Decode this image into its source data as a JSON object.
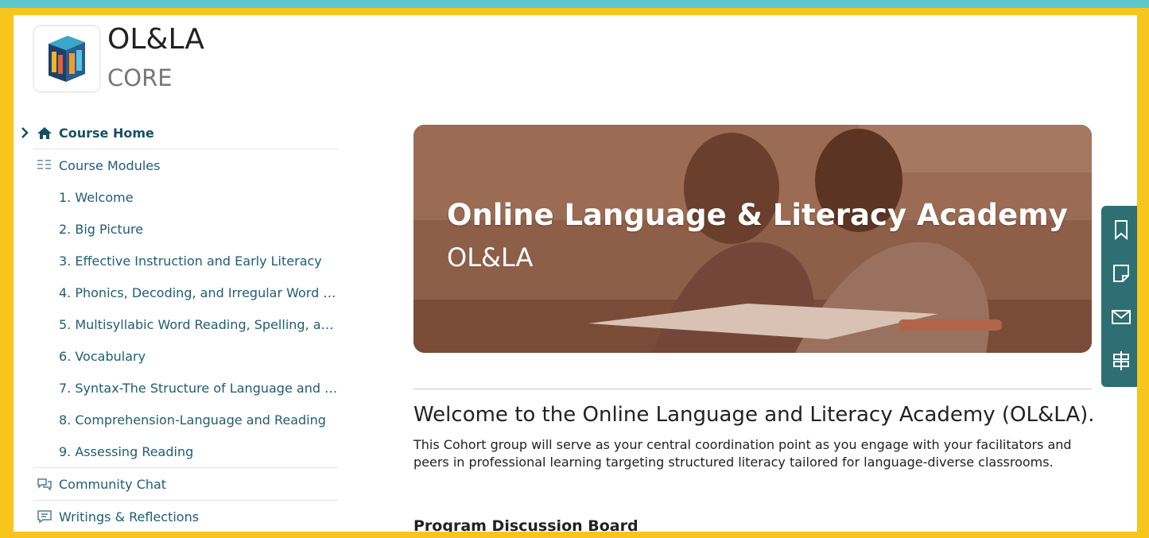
{
  "header": {
    "title": "OL&LA",
    "subtitle": "CORE"
  },
  "sidebar": {
    "home": {
      "label": "Course Home",
      "icon": "home-icon"
    },
    "modules": {
      "label": "Course Modules",
      "icon": "list-icon"
    },
    "module_items": [
      "1. Welcome",
      "2. Big Picture",
      "3. Effective Instruction and Early Literacy",
      "4. Phonics, Decoding, and Irregular Word Re...",
      "5. Multisyllabic Word Reading, Spelling, and...",
      "6. Vocabulary",
      "7. Syntax-The Structure of Language and W...",
      "8. Comprehension-Language and Reading",
      "9. Assessing Reading"
    ],
    "chat": {
      "label": "Community Chat",
      "icon": "chat-icon"
    },
    "writings": {
      "label": "Writings & Reflections",
      "icon": "comment-icon"
    }
  },
  "hero": {
    "title": "Online Language & Literacy Academy",
    "subtitle": "OL&LA"
  },
  "content": {
    "welcome": "Welcome to the Online Language and Literacy Academy (OL&LA).",
    "description": "This Cohort group will serve as your central coordination point as you engage with your facilitators and peers in professional learning targeting structured literacy tailored for language-diverse classrooms.",
    "board_heading": "Program Discussion Board"
  },
  "toolbar": {
    "icons": [
      "bookmark-icon",
      "note-icon",
      "mail-icon",
      "signpost-icon"
    ]
  },
  "colors": {
    "nav_text": "#1f5d74",
    "toolbar_bg": "#2d6f72",
    "frame": "#f7c51c",
    "outer": "#5ec8cf"
  }
}
